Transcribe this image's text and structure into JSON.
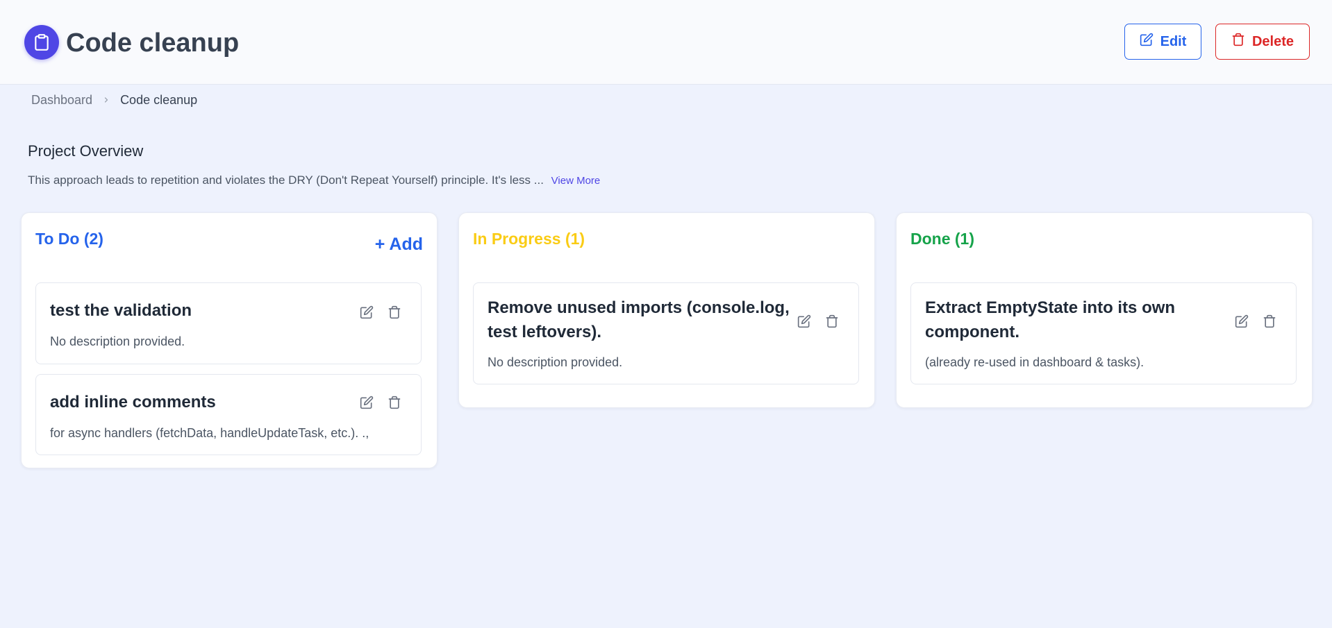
{
  "header": {
    "title": "Code cleanup",
    "logo_icon": "clipboard-icon",
    "edit_label": "Edit",
    "delete_label": "Delete"
  },
  "breadcrumb": {
    "items": [
      "Dashboard",
      "Code cleanup"
    ]
  },
  "overview": {
    "title": "Project Overview",
    "description": "This approach leads to repetition and violates the DRY (Don't Repeat Yourself) principle. It's less ...",
    "view_more": "View More"
  },
  "columns": [
    {
      "title": "To Do (2)",
      "color": "#2563eb",
      "add_label": "+ Add",
      "tasks": [
        {
          "title": "test the validation",
          "description": "No description provided."
        },
        {
          "title": "add inline comments",
          "description": "for async handlers (fetchData, handleUpdateTask, etc.). .,"
        }
      ]
    },
    {
      "title": "In Progress (1)",
      "color": "#facc15",
      "tasks": [
        {
          "title_lines": [
            "Remove unused imports (console.log,",
            "test leftovers)."
          ],
          "description": "No description provided."
        }
      ]
    },
    {
      "title": "Done (1)",
      "color": "#16a34a",
      "tasks": [
        {
          "title_lines": [
            "Extract EmptyState into its own",
            "component."
          ],
          "description": "(already re-used in dashboard & tasks)."
        }
      ]
    }
  ],
  "colors": {
    "accent": "#4f46e5",
    "edit": "#2563eb",
    "delete": "#dc2626",
    "background": "#eef2fd"
  }
}
